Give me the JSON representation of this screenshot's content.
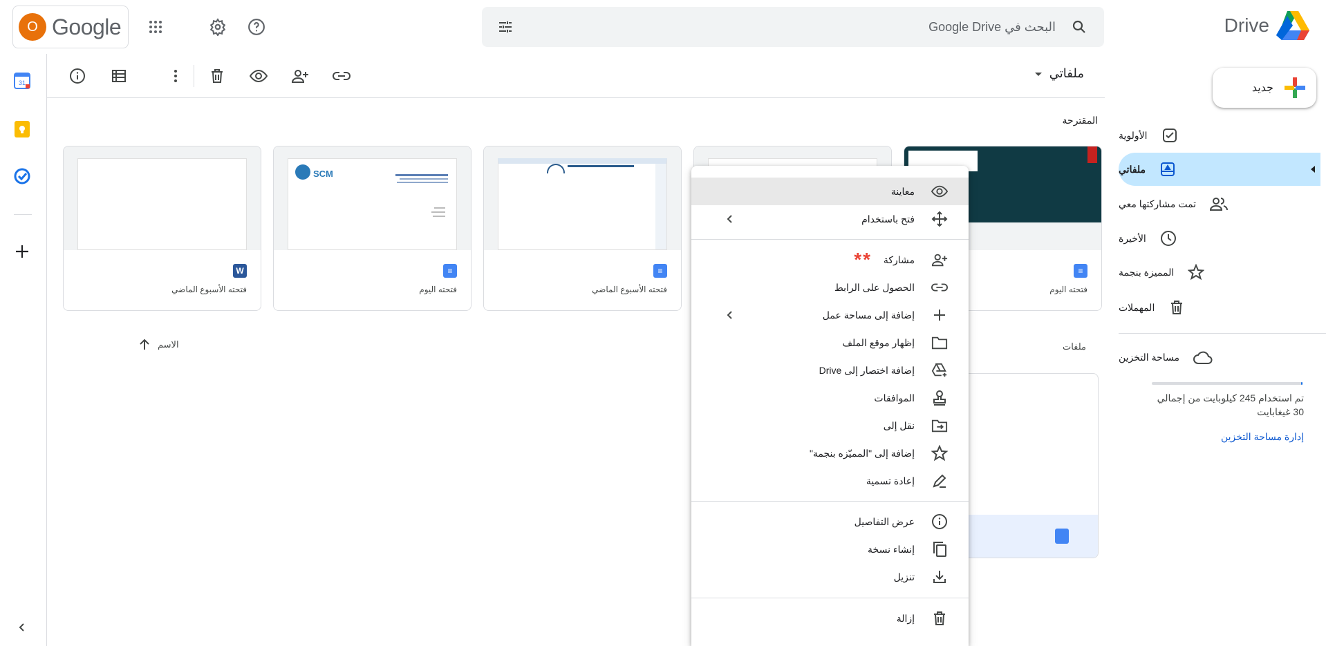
{
  "header": {
    "avatar_letter": "O",
    "logo_text": "Google",
    "search_placeholder": "البحث في Google Drive",
    "brand": "Drive"
  },
  "rail": {
    "calendar_day": "31"
  },
  "nav": {
    "new_label": "جديد",
    "items": [
      {
        "label": "الأولوية",
        "icon": "priority-icon"
      },
      {
        "label": "ملفاتي",
        "icon": "my-drive-icon",
        "active": true
      },
      {
        "label": "تمت مشاركتها معي",
        "icon": "shared-icon"
      },
      {
        "label": "الأخيرة",
        "icon": "recent-icon"
      },
      {
        "label": "المميزة بنجمة",
        "icon": "star-icon"
      },
      {
        "label": "المهملات",
        "icon": "trash-icon"
      }
    ],
    "storage_label": "مساحة التخزين",
    "storage_used_text": "تم استخدام 245 كيلوبايت من إجمالي 30 غيغابايت",
    "storage_used_fraction": 0.01,
    "storage_manage": "إدارة مساحة التخزين"
  },
  "toolbar": {
    "title": "ملفاتي"
  },
  "main": {
    "suggested_label": "المقترحة",
    "files_label": "ملفات",
    "sort_label": "الاسم",
    "cards": [
      {
        "caption": "فتحته الأسبوع الماضي",
        "type": "word"
      },
      {
        "caption": "فتحته اليوم",
        "type": "docs",
        "logo": "SCM"
      },
      {
        "caption": "فتحته الأسبوع الماضي",
        "type": "docs"
      },
      {
        "caption": "",
        "type": "docs"
      },
      {
        "caption": "فتحته اليوم",
        "type": "docs"
      }
    ]
  },
  "context_menu": {
    "items": [
      {
        "label": "معاينة",
        "icon": "eye-icon"
      },
      {
        "label": "فتح باستخدام",
        "icon": "open-with-icon",
        "submenu": true
      },
      {
        "label": "مشاركة",
        "icon": "share-person-icon",
        "marker": "**"
      },
      {
        "label": "الحصول على الرابط",
        "icon": "link-icon"
      },
      {
        "label": "إضافة إلى مساحة عمل",
        "icon": "plus-icon",
        "submenu": true
      },
      {
        "label": "إظهار موقع الملف",
        "icon": "folder-icon"
      },
      {
        "label": "إضافة اختصار إلى Drive",
        "icon": "drive-shortcut-icon"
      },
      {
        "label": "الموافقات",
        "icon": "approval-stamp-icon"
      },
      {
        "label": "نقل إلى",
        "icon": "move-to-folder-icon"
      },
      {
        "label": "إضافة إلى \"المميّزه بنجمة\"",
        "icon": "star-outline-icon"
      },
      {
        "label": "إعادة تسمية",
        "icon": "rename-pen-icon"
      },
      {
        "label": "عرض التفاصيل",
        "icon": "info-icon"
      },
      {
        "label": "إنشاء نسخة",
        "icon": "copy-icon"
      },
      {
        "label": "تنزيل",
        "icon": "download-icon"
      },
      {
        "label": "إزالة",
        "icon": "trash-icon"
      }
    ]
  },
  "colors": {
    "accent_blue": "#1a73e8",
    "active_nav_bg": "#c2e7ff",
    "avatar": "#e8710a",
    "marker_red": "#ea4335"
  }
}
